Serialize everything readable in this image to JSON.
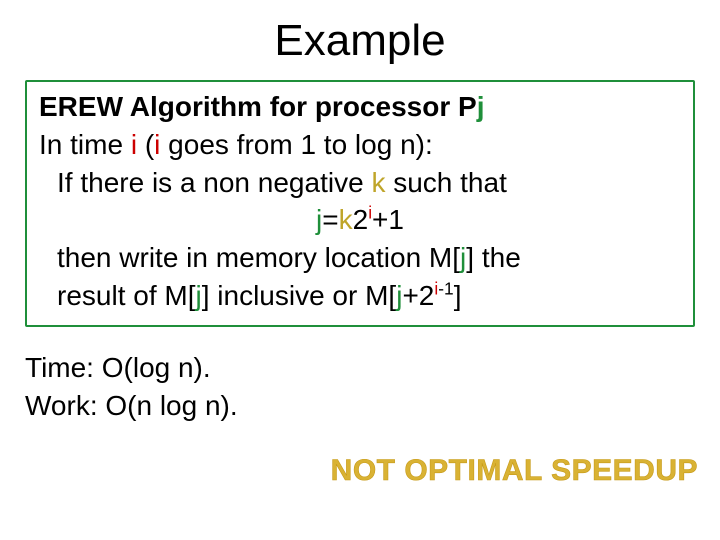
{
  "title": "Example",
  "algo": {
    "line1_pre": "EREW Algorithm for processor P",
    "line1_j": "j",
    "line2_a": "In time ",
    "line2_i": "i",
    "line2_b": " (",
    "line2_i2": "i",
    "line2_c": " goes from 1 to log n):",
    "line3_a": "If there is a non negative ",
    "line3_k": "k",
    "line3_b": " such that",
    "line4_j": "j",
    "line4_eq": "=",
    "line4_k": "k",
    "line4_mid": "2",
    "line4_sup_i": "i",
    "line4_tail": "+1",
    "line5_a": "then write in memory location M[",
    "line5_j": "j",
    "line5_b": "] the",
    "line6_a": "result of M[",
    "line6_j1": "j",
    "line6_b": "] inclusive or M[",
    "line6_j2": "j",
    "line6_c": "+2",
    "line6_sup_i": "i",
    "line6_supminus": "-1",
    "line6_d": "]"
  },
  "bottom": {
    "time": "Time: O(log n).",
    "work": "Work: O(n log n)."
  },
  "not_optimal": "NOT OPTIMAL SPEEDUP"
}
